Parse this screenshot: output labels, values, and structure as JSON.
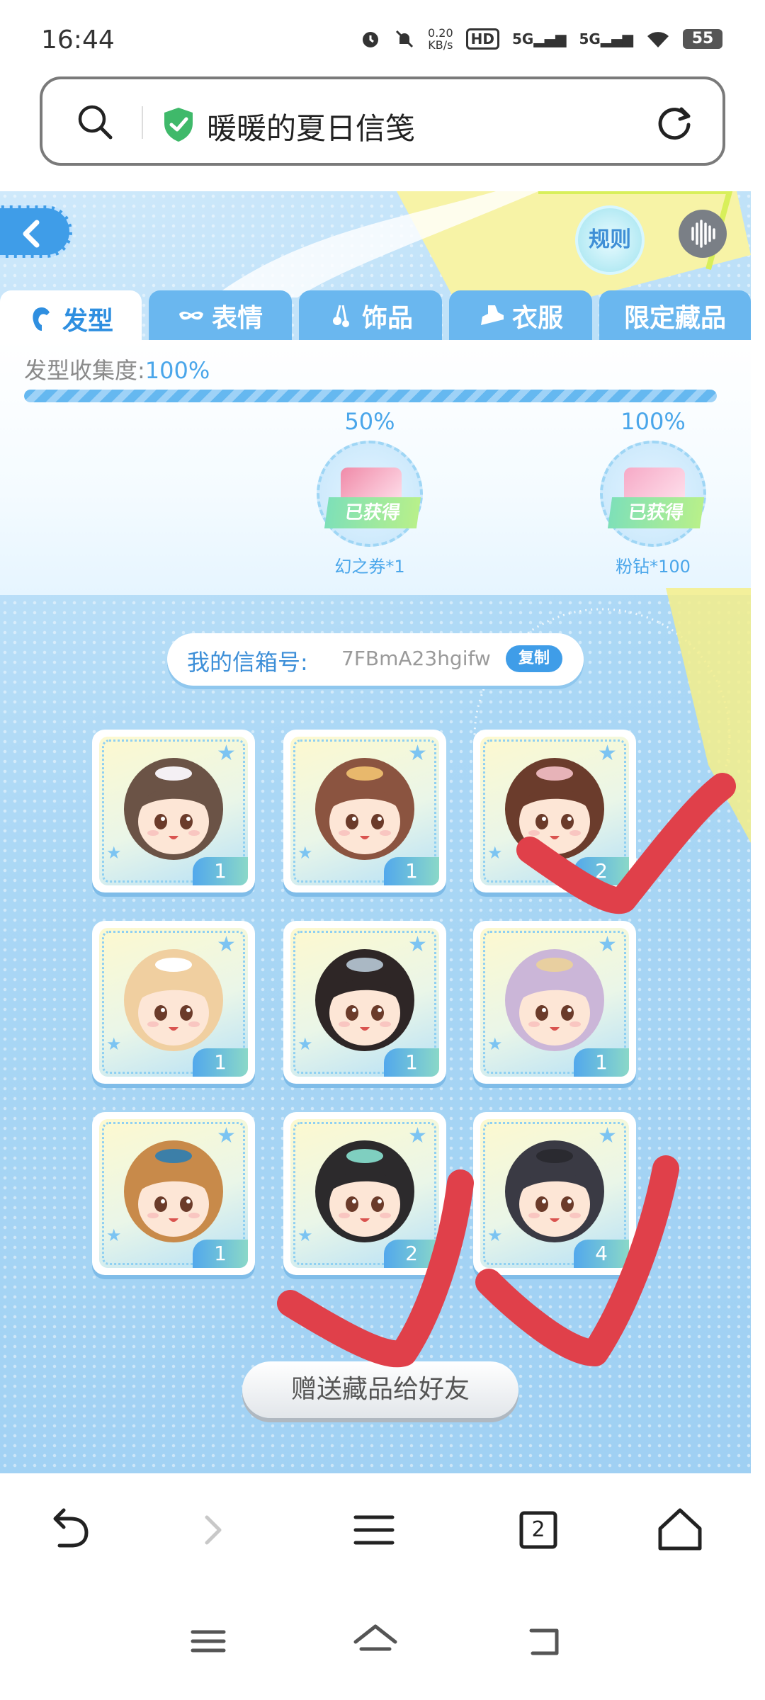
{
  "status_bar": {
    "time": "16:44",
    "speed": "0.20",
    "speed_unit": "KB/s",
    "hd_label": "HD",
    "network1": "5G",
    "network2": "5G",
    "battery": "55"
  },
  "address_bar": {
    "title": "暖暖的夏日信笺"
  },
  "game": {
    "rules_label": "规则",
    "tabs": [
      {
        "label": "发型",
        "icon": "hair-icon",
        "active": true
      },
      {
        "label": "表情",
        "icon": "mask-icon",
        "active": false
      },
      {
        "label": "饰品",
        "icon": "accessory-icon",
        "active": false
      },
      {
        "label": "衣服",
        "icon": "clothes-icon",
        "active": false
      },
      {
        "label": "限定藏品",
        "icon": "",
        "active": false
      }
    ],
    "collection": {
      "label": "发型收集度:",
      "percent_text": "100%",
      "progress": 100,
      "rewards": [
        {
          "percent": "50%",
          "status": "已获得",
          "name": "幻之券*1",
          "color": "#f08aa8"
        },
        {
          "percent": "100%",
          "status": "已获得",
          "name": "粉钻*100",
          "color": "#f6a9c6"
        }
      ]
    },
    "mailbox": {
      "label": "我的信箱号:",
      "code": "7FBmA23hgifw",
      "copy_label": "复制"
    },
    "items": [
      {
        "count": "1",
        "hair": "#6b5346",
        "accent": "#f4f0f4"
      },
      {
        "count": "1",
        "hair": "#8b5440",
        "accent": "#e8b86c"
      },
      {
        "count": "2",
        "hair": "#6b3c2c",
        "accent": "#e7b3b8"
      },
      {
        "count": "1",
        "hair": "#f0cfa0",
        "accent": "#ffffff"
      },
      {
        "count": "1",
        "hair": "#2e2626",
        "accent": "#aab8c4"
      },
      {
        "count": "1",
        "hair": "#cbb6d8",
        "accent": "#e8cfa0"
      },
      {
        "count": "1",
        "hair": "#c88a4a",
        "accent": "#3c7fa8"
      },
      {
        "count": "2",
        "hair": "#2c2a2c",
        "accent": "#7fcfc0"
      },
      {
        "count": "4",
        "hair": "#3a3a44",
        "accent": "#2a2a30"
      }
    ],
    "gift_label": "赠送藏品给好友"
  },
  "browser_toolbar": {
    "tabs_count": "2"
  },
  "colors": {
    "accent_blue": "#3f9de8",
    "check_red": "#e0404a"
  }
}
